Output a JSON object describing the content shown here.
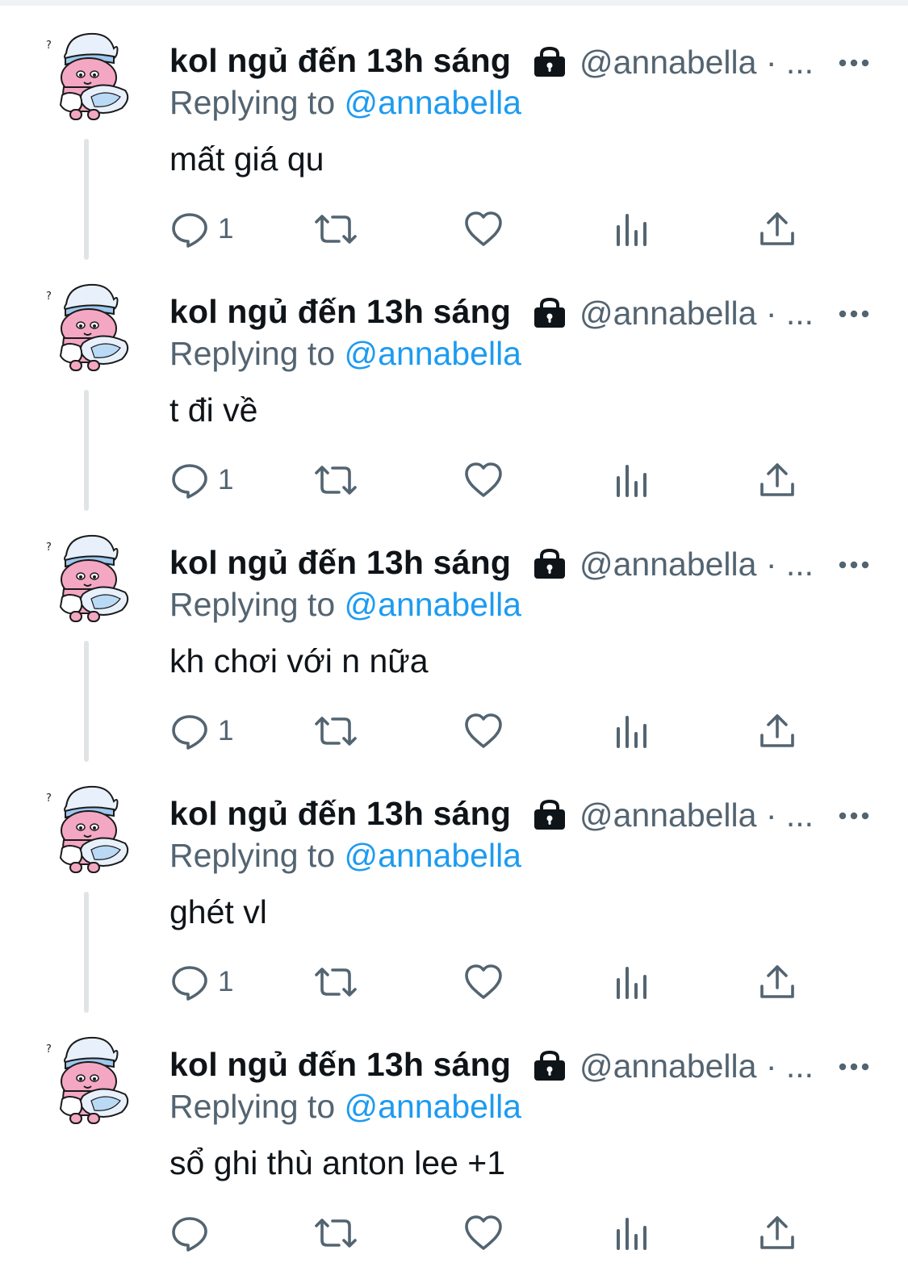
{
  "colors": {
    "text_primary": "#0f1419",
    "text_secondary": "#536471",
    "accent": "#1d9bf0",
    "thread_line": "#e1e4e6"
  },
  "tweets": [
    {
      "author_name": "kol ngủ đến 13h sáng",
      "handle": "@annabella · ...",
      "replying_prefix": "Replying to",
      "replying_to": "@annabella",
      "text": "mất giá qu",
      "reply_count": "1",
      "has_thread_line": true
    },
    {
      "author_name": "kol ngủ đến 13h sáng",
      "handle": "@annabella · ...",
      "replying_prefix": "Replying to",
      "replying_to": "@annabella",
      "text": "t đi về",
      "reply_count": "1",
      "has_thread_line": true
    },
    {
      "author_name": "kol ngủ đến 13h sáng",
      "handle": "@annabella · ...",
      "replying_prefix": "Replying to",
      "replying_to": "@annabella",
      "text": "kh chơi với n nữa",
      "reply_count": "1",
      "has_thread_line": true
    },
    {
      "author_name": "kol ngủ đến 13h sáng",
      "handle": "@annabella · ...",
      "replying_prefix": "Replying to",
      "replying_to": "@annabella",
      "text": "ghét vl",
      "reply_count": "1",
      "has_thread_line": true
    },
    {
      "author_name": "kol ngủ đến 13h sáng",
      "handle": "@annabella · ...",
      "replying_prefix": "Replying to",
      "replying_to": "@annabella",
      "text": "sổ ghi thù anton lee +1",
      "reply_count": "",
      "has_thread_line": false
    }
  ],
  "icons": {
    "avatar": "pink-character-with-nightcap-hugging-pillow-avatar",
    "lock": "lock-icon",
    "more": "more-dots-icon",
    "reply": "reply-bubble-icon",
    "retweet": "retweet-icon",
    "like": "heart-icon",
    "views": "views-chart-icon",
    "share": "share-upload-icon"
  }
}
